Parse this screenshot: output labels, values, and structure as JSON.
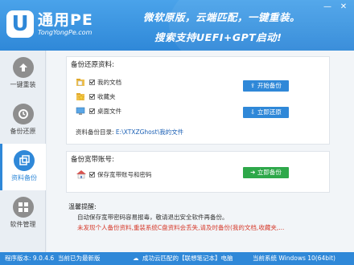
{
  "header": {
    "logo_letter": "U",
    "app_name": "通用PE",
    "url": "TongYongPe.com",
    "slogan_line1": "微软原版，云端匹配，一键重装。",
    "slogan_line2": "搜索支持UEFI+GPT启动!",
    "minimize_label": "—",
    "close_label": "✕"
  },
  "sidebar": {
    "items": [
      {
        "label": "一键重装",
        "icon": "reinstall-icon",
        "active": false
      },
      {
        "label": "备份还原",
        "icon": "backup-restore-icon",
        "active": false
      },
      {
        "label": "资料备份",
        "icon": "data-backup-icon",
        "active": true
      },
      {
        "label": "软件管理",
        "icon": "software-icon",
        "active": false
      }
    ]
  },
  "backup_section": {
    "title": "备份还原资料:",
    "items": [
      {
        "label": "我的文档",
        "checked": true
      },
      {
        "label": "收藏夹",
        "checked": true
      },
      {
        "label": "桌面文件",
        "checked": true
      }
    ],
    "start_backup_label": "开始备份",
    "restore_now_label": "立即还原",
    "dir_label": "资料备份目录:",
    "dir_path": "E:\\XTXZGhost\\我的文件"
  },
  "broadband_section": {
    "title": "备份宽带账号:",
    "item_label": "保存宽带账号和密码",
    "checked": true,
    "backup_now_label": "立即备份"
  },
  "notice": {
    "title": "温馨提醒:",
    "line1": "自动保存宽带密码容易报毒，敬请退出安全软件再备份。",
    "line2": "未发现个人备份资料,重装系统C盘资料会丢失,请及时备份(我的文档,收藏夹,..."
  },
  "status_bar": {
    "version": "程序版本: 9.0.4.6",
    "update": "当前已为最新版",
    "match_status": "成功云匹配的【联想笔记本】电脑",
    "os": "当前系统 Windows 10(64bit)"
  },
  "colors": {
    "accent": "#2f88d8",
    "green": "#2ea84a",
    "warning": "#d63a2b"
  }
}
